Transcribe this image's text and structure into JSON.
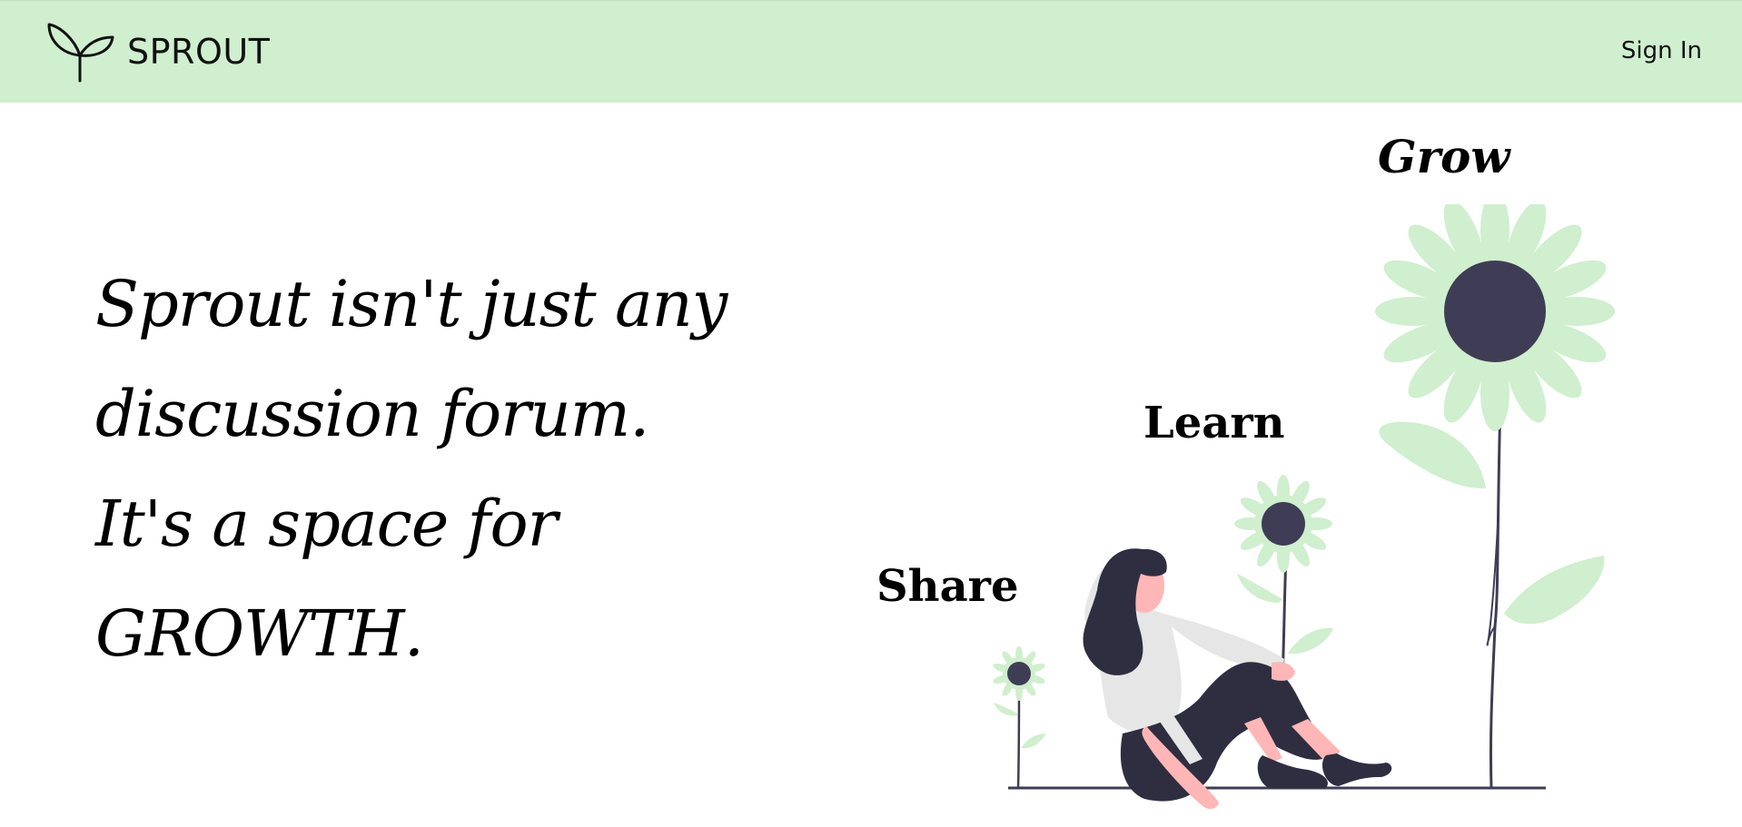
{
  "brand": {
    "name": "SPROUT",
    "logo_icon": "sprout-icon"
  },
  "nav": {
    "sign_in": "Sign In"
  },
  "hero": {
    "lines": [
      "Sprout isn't just any",
      "discussion forum.",
      "It's a space for",
      "GROWTH."
    ]
  },
  "illustration": {
    "labels": {
      "grow": "Grow",
      "learn": "Learn",
      "share": "Share"
    },
    "icon": "woman-with-flowers-illustration"
  },
  "colors": {
    "navbar_bg": "#cfefce",
    "petal": "#cfefce",
    "flower_center": "#3f3d56",
    "skin": "#ffb6b6",
    "clothing_dark": "#2f2e41",
    "shirt": "#e6e6e6"
  }
}
